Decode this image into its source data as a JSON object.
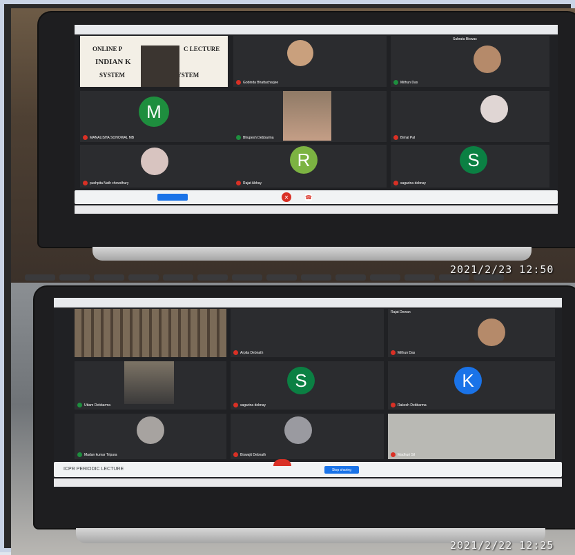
{
  "photos": [
    {
      "timestamp": "2021/2/23  12:50",
      "slide": {
        "line1": "ONLINE P",
        "line1b": "C LECTURE",
        "line2": "INDIAN K",
        "line3": "SYSTEM",
        "line3b": "S SYSTEM"
      },
      "participants": [
        {
          "name": "Gobinda Bhattacharjee",
          "avatar": "photo",
          "muted": true
        },
        {
          "name": "Mithun Das",
          "avatar": "photo",
          "muted": false
        },
        {
          "name": "Subrata Biswas",
          "avatar": "photo",
          "muted": false
        },
        {
          "name": "MANALISHA SONOWAL MB",
          "avatar": "M",
          "color": "#1e8e3e",
          "muted": true
        },
        {
          "name": "Bhupesh Debbarma",
          "avatar": "photo",
          "muted": false
        },
        {
          "name": "Bimal Pal",
          "avatar": "photo",
          "muted": true
        },
        {
          "name": "pushpita Nath chowdhury",
          "avatar": "photo",
          "muted": true
        },
        {
          "name": "Rajat Abhay",
          "avatar": "R",
          "color": "#7cb342",
          "muted": true
        },
        {
          "name": "sagarina debnay",
          "avatar": "S",
          "color": "#0b8043",
          "muted": true
        }
      ]
    },
    {
      "timestamp": "2021/2/22  12:25",
      "meeting_title": "ICPR PERIODIC LECTURE",
      "present_button": "Stop sharing",
      "participants": [
        {
          "name": "Arpita Debnath",
          "avatar": "photo",
          "muted": true
        },
        {
          "name": "Mithun Das",
          "avatar": "photo",
          "muted": true
        },
        {
          "name": "Rajat Dewan",
          "avatar": "photo",
          "muted": false
        },
        {
          "name": "Uttam Debbarma",
          "avatar": "photo",
          "muted": false
        },
        {
          "name": "sagarina debnay",
          "avatar": "S",
          "color": "#0b8043",
          "muted": true
        },
        {
          "name": "Rakesh Debbarma",
          "avatar": "K",
          "color": "#1a73e8",
          "muted": true
        },
        {
          "name": "Madan kumar Tripura",
          "avatar": "photo",
          "muted": false
        },
        {
          "name": "Biswajit Debnath",
          "avatar": "photo",
          "muted": true
        },
        {
          "name": "Madhuri Sil",
          "avatar": "photo",
          "muted": true
        }
      ]
    }
  ],
  "colors": {
    "meet_bg": "#202124",
    "tile_bg": "#3c4043",
    "red": "#d93025",
    "blue": "#1a73e8"
  }
}
